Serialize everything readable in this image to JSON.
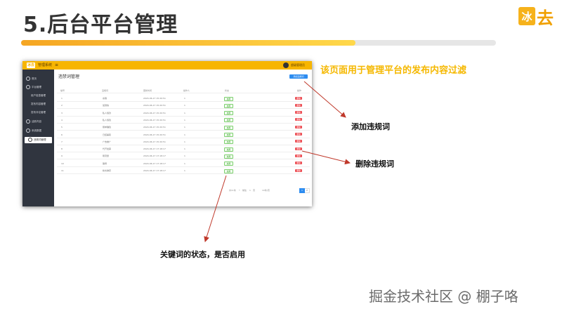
{
  "slide": {
    "title": "5.后台平台管理",
    "brand_icon_text": "冰",
    "brand_text": "去",
    "accent_color": "#f5a623",
    "watermark": "掘金技术社区 @ 棚子咯"
  },
  "app": {
    "logo_text": "冰去",
    "name": "管理系统",
    "menu_icon": "hamburger-icon",
    "user_name": "超级管理员"
  },
  "sidebar": {
    "items": [
      {
        "label": "首页",
        "sub": false,
        "active": false
      },
      {
        "label": "平台管理",
        "sub": false,
        "active": false
      },
      {
        "label": "用户信息管理",
        "sub": true,
        "active": false
      },
      {
        "label": "发布内容管理",
        "sub": true,
        "active": false
      },
      {
        "label": "发布评论管理",
        "sub": true,
        "active": false
      },
      {
        "label": "活跃内容",
        "sub": false,
        "active": false
      },
      {
        "label": "系统数据",
        "sub": false,
        "active": false
      },
      {
        "label": "违规词管理",
        "sub": false,
        "active": true
      }
    ]
  },
  "main": {
    "page_title": "违禁词管理",
    "add_button": "添加违规词",
    "columns": [
      "编号",
      "违规词",
      "更新时间",
      "操作人",
      "状态",
      "操作"
    ],
    "status_label": "启用",
    "delete_label": "删除",
    "rows": [
      {
        "id": "1",
        "word": "杀猪",
        "time": "2024-06-17 15:20:51",
        "operator": "1"
      },
      {
        "id": "2",
        "word": "加微信",
        "time": "2024-06-17 15:20:51",
        "operator": "1"
      },
      {
        "id": "3",
        "word": "私人借款",
        "time": "2024-06-17 15:20:51",
        "operator": "1"
      },
      {
        "id": "4",
        "word": "私人借钱",
        "time": "2024-06-17 15:20:51",
        "operator": "1"
      },
      {
        "id": "5",
        "word": "刷单赚钱",
        "time": "2024-06-17 15:20:51",
        "operator": "1"
      },
      {
        "id": "6",
        "word": "日结兼职",
        "time": "2024-06-17 15:20:51",
        "operator": "1"
      },
      {
        "id": "7",
        "word": "广告推广",
        "time": "2024-06-17 15:20:51",
        "operator": "1"
      },
      {
        "id": "8",
        "word": "代开发票",
        "time": "2024-06-17 17:18:17",
        "operator": "1"
      },
      {
        "id": "9",
        "word": "刷流量",
        "time": "2024-06-17 17:18:17",
        "operator": "1"
      },
      {
        "id": "10",
        "word": "赌博",
        "time": "2024-06-17 17:18:17",
        "operator": "1"
      },
      {
        "id": "11",
        "word": "枪支弹药",
        "time": "2024-06-17 17:18:17",
        "operator": "1"
      }
    ],
    "pager": {
      "total": "共11条",
      "size": "10条/页",
      "goto": "前往",
      "page_unit": "页",
      "pages": [
        "1",
        "2"
      ],
      "current": "1"
    }
  },
  "annotations": {
    "description": "该页面用于管理平台的发布内容过滤",
    "add_label": "添加违规词",
    "delete_label": "删除违规词",
    "status_label": "关键词的状态，是否启用"
  }
}
